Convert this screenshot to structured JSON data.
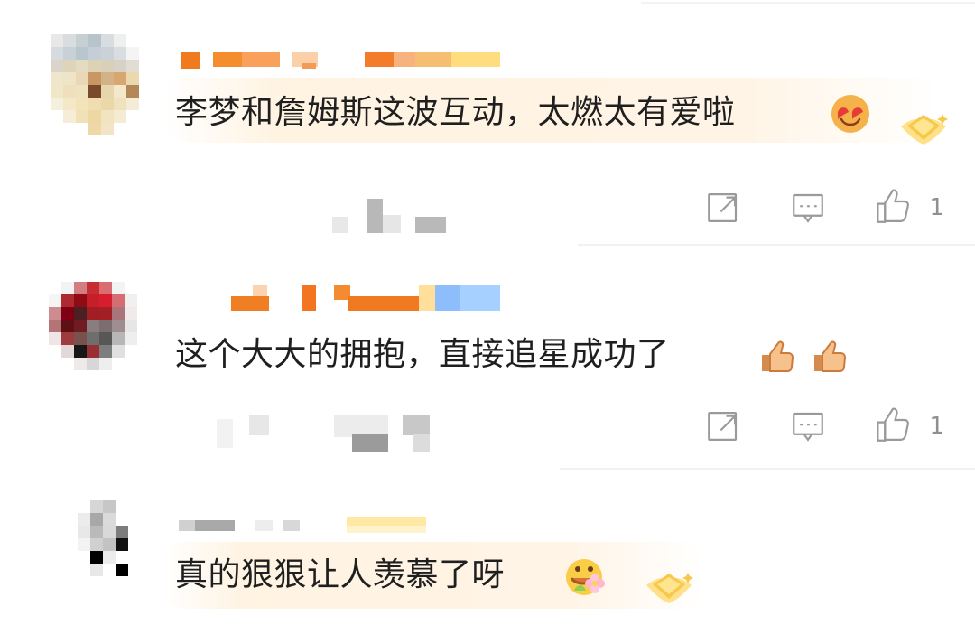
{
  "comments": [
    {
      "text": "李梦和詹姆斯这波互动，太燃太有爱啦",
      "emoji_icon": "heart-eyes-emoji-icon",
      "has_badge": true,
      "like_count": "1"
    },
    {
      "text": "这个大大的拥抱，直接追星成功了",
      "emoji_icon": "thumbs-up-emoji-icon",
      "has_badge": false,
      "like_count": "1"
    },
    {
      "text": "真的狠狠让人羡慕了呀",
      "emoji_icon": "flower-face-emoji-icon",
      "has_badge": true,
      "like_count": ""
    }
  ],
  "colors": {
    "text": "#1f1f1f",
    "icon_gray": "#9a9a9a",
    "name_orange": "#f08a28",
    "name_blue": "#9cc8ff",
    "badge_gold": "#f5c44b"
  }
}
